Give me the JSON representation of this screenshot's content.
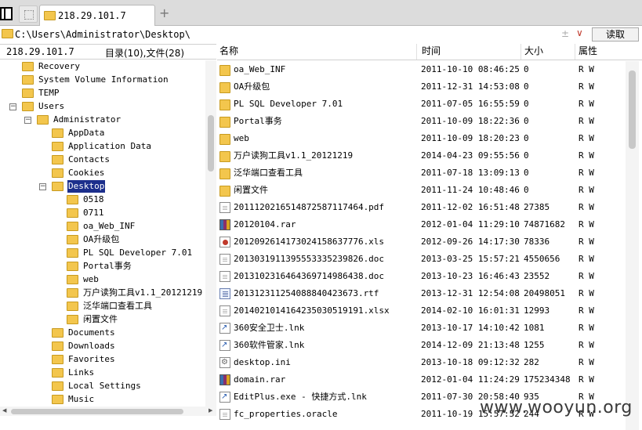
{
  "tab": {
    "title": "218.29.101.7",
    "add_symbol": "+"
  },
  "address": {
    "path": "C:\\Users\\Administrator\\Desktop\\",
    "history_symbol": "±",
    "dropdown_symbol": "∨",
    "read_label": "读取"
  },
  "left_panel": {
    "host": "218.29.101.7",
    "summary": "目录(10),文件(28)"
  },
  "tree": [
    {
      "label": "Recovery",
      "level": 1,
      "expander": "",
      "selected": false
    },
    {
      "label": "System Volume Information",
      "level": 1,
      "expander": "",
      "selected": false
    },
    {
      "label": "TEMP",
      "level": 1,
      "expander": "",
      "selected": false
    },
    {
      "label": "Users",
      "level": 1,
      "expander": "−",
      "selected": false
    },
    {
      "label": "Administrator",
      "level": 2,
      "expander": "−",
      "selected": false
    },
    {
      "label": "AppData",
      "level": 3,
      "expander": "",
      "selected": false
    },
    {
      "label": "Application Data",
      "level": 3,
      "expander": "",
      "selected": false
    },
    {
      "label": "Contacts",
      "level": 3,
      "expander": "",
      "selected": false
    },
    {
      "label": "Cookies",
      "level": 3,
      "expander": "",
      "selected": false
    },
    {
      "label": "Desktop",
      "level": 3,
      "expander": "−",
      "selected": true
    },
    {
      "label": "0518",
      "level": 4,
      "expander": "",
      "selected": false
    },
    {
      "label": "0711",
      "level": 4,
      "expander": "",
      "selected": false
    },
    {
      "label": "oa_Web_INF",
      "level": 4,
      "expander": "",
      "selected": false
    },
    {
      "label": "OA升级包",
      "level": 4,
      "expander": "",
      "selected": false
    },
    {
      "label": "PL SQL Developer 7.01",
      "level": 4,
      "expander": "",
      "selected": false
    },
    {
      "label": "Portal事务",
      "level": 4,
      "expander": "",
      "selected": false
    },
    {
      "label": "web",
      "level": 4,
      "expander": "",
      "selected": false
    },
    {
      "label": "万户读狗工具v1.1_20121219",
      "level": 4,
      "expander": "",
      "selected": false
    },
    {
      "label": "泛华端口查看工具",
      "level": 4,
      "expander": "",
      "selected": false
    },
    {
      "label": "闲置文件",
      "level": 4,
      "expander": "",
      "selected": false
    },
    {
      "label": "Documents",
      "level": 3,
      "expander": "",
      "selected": false
    },
    {
      "label": "Downloads",
      "level": 3,
      "expander": "",
      "selected": false
    },
    {
      "label": "Favorites",
      "level": 3,
      "expander": "",
      "selected": false
    },
    {
      "label": "Links",
      "level": 3,
      "expander": "",
      "selected": false
    },
    {
      "label": "Local Settings",
      "level": 3,
      "expander": "",
      "selected": false
    },
    {
      "label": "Music",
      "level": 3,
      "expander": "",
      "selected": false
    }
  ],
  "columns": {
    "name": "名称",
    "time": "时间",
    "size": "大小",
    "attr": "属性"
  },
  "files": [
    {
      "name": "oa_Web_INF",
      "time": "2011-10-10 08:46:25",
      "size": "0",
      "attr": "R W",
      "icon": "folder"
    },
    {
      "name": "OA升级包",
      "time": "2011-12-31 14:53:08",
      "size": "0",
      "attr": "R W",
      "icon": "folder"
    },
    {
      "name": "PL SQL Developer 7.01",
      "time": "2011-07-05 16:55:59",
      "size": "0",
      "attr": "R W",
      "icon": "folder"
    },
    {
      "name": "Portal事务",
      "time": "2011-10-09 18:22:36",
      "size": "0",
      "attr": "R W",
      "icon": "folder"
    },
    {
      "name": "web",
      "time": "2011-10-09 18:20:23",
      "size": "0",
      "attr": "R W",
      "icon": "folder"
    },
    {
      "name": "万户读狗工具v1.1_20121219",
      "time": "2014-04-23 09:55:56",
      "size": "0",
      "attr": "R W",
      "icon": "folder"
    },
    {
      "name": "泛华端口查看工具",
      "time": "2011-07-18 13:09:13",
      "size": "0",
      "attr": "R W",
      "icon": "folder"
    },
    {
      "name": "闲置文件",
      "time": "2011-11-24 10:48:46",
      "size": "0",
      "attr": "R W",
      "icon": "folder"
    },
    {
      "name": "20111202165148725871174​64.pdf",
      "time": "2011-12-02 16:51:48",
      "size": "27385",
      "attr": "R W",
      "icon": "doc"
    },
    {
      "name": "20120104.rar",
      "time": "2012-01-04 11:29:10",
      "size": "74871682",
      "attr": "R W",
      "icon": "rar"
    },
    {
      "name": "20120926141730241586377​76.xls",
      "time": "2012-09-26 14:17:30",
      "size": "78336",
      "attr": "R W",
      "icon": "xls"
    },
    {
      "name": "20130319113955533352398​26.doc",
      "time": "2013-03-25 15:57:21",
      "size": "4550656",
      "attr": "R W",
      "icon": "doc"
    },
    {
      "name": "20131023164643697149864​38.doc",
      "time": "2013-10-23 16:46:43",
      "size": "23552",
      "attr": "R W",
      "icon": "doc"
    },
    {
      "name": "20131231125408884042367​3.rtf",
      "time": "2013-12-31 12:54:08",
      "size": "20498051",
      "attr": "R W",
      "icon": "rtf"
    },
    {
      "name": "20140210141642350305191​91.xlsx",
      "time": "2014-02-10 16:01:31",
      "size": "12993",
      "attr": "R W",
      "icon": "doc"
    },
    {
      "name": "360安全卫士.lnk",
      "time": "2013-10-17 14:10:42",
      "size": "1081",
      "attr": "R W",
      "icon": "lnk"
    },
    {
      "name": "360软件管家.lnk",
      "time": "2014-12-09 21:13:48",
      "size": "1255",
      "attr": "R W",
      "icon": "lnk"
    },
    {
      "name": "desktop.ini",
      "time": "2013-10-18 09:12:32",
      "size": "282",
      "attr": "R W",
      "icon": "ini"
    },
    {
      "name": "domain.rar",
      "time": "2012-01-04 11:24:29",
      "size": "175234348",
      "attr": "R W",
      "icon": "rar"
    },
    {
      "name": "EditPlus.exe - 快捷方式.lnk",
      "time": "2011-07-30 20:58:40",
      "size": "935",
      "attr": "R W",
      "icon": "lnk"
    },
    {
      "name": "fc_properties.oracle",
      "time": "2011-10-19 15:57:52",
      "size": "244",
      "attr": "R W",
      "icon": "doc"
    }
  ],
  "watermark": "www.wooyun.org"
}
